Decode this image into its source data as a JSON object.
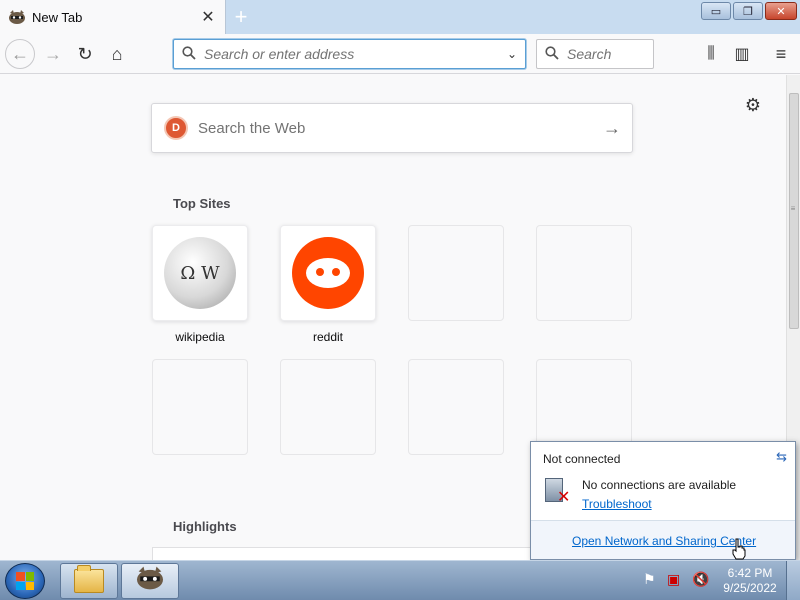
{
  "browser": {
    "tab": {
      "title": "New Tab",
      "close_glyph": "✕",
      "favicon": "raccoon-icon"
    },
    "new_tab_glyph": "+",
    "window_controls": {
      "minimize": "▭",
      "maximize": "❐",
      "close": "✕"
    },
    "nav": {
      "back": "←",
      "forward": "→",
      "reload": "↻",
      "home": "⌂"
    },
    "urlbar": {
      "placeholder": "Search or enter address",
      "dropdown_glyph": "⌄"
    },
    "searchbar": {
      "placeholder": "Search"
    },
    "toolbar": {
      "library": "⫼",
      "sidebar": "▥",
      "menu": "≡"
    }
  },
  "newtab": {
    "settings_glyph": "⚙",
    "websearch": {
      "placeholder": "Search the Web",
      "arrow": "→",
      "engine_icon": "duckduckgo-icon"
    },
    "top_sites_title": "Top Sites",
    "top_sites": [
      {
        "label": "wikipedia",
        "icon": "wikipedia-icon"
      },
      {
        "label": "reddit",
        "icon": "reddit-icon"
      }
    ],
    "highlights_title": "Highlights"
  },
  "network_popup": {
    "header": "Not connected",
    "message": "No connections are available",
    "troubleshoot": "Troubleshoot",
    "footer_link": "Open Network and Sharing Center"
  },
  "taskbar": {
    "clock_time": "6:42 PM",
    "clock_date": "9/25/2022"
  },
  "colors": {
    "accent_blue": "#0066cc",
    "reddit_orange": "#ff4500",
    "ddg_orange": "#de5833",
    "error_red": "#d60000"
  }
}
